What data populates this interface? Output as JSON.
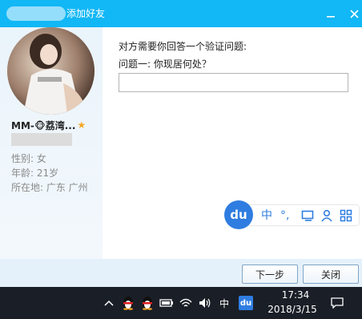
{
  "window": {
    "title": "添加好友",
    "minimize_icon": "minimize-icon",
    "close_icon": "close-icon",
    "title_color": "#12b7f5"
  },
  "profile": {
    "nickname": "MM-🐵荔湾...",
    "star_icon": "star-icon",
    "gender": "性别: 女",
    "age": "年龄: 21岁",
    "location": "所在地: 广东  广州"
  },
  "question": {
    "intro": "对方需要你回答一个验证问题:",
    "q1": "问题一: 你现居何处？",
    "answer_value": ""
  },
  "ime": {
    "logo": "du",
    "lang": "中",
    "punct": "°,",
    "items": [
      "中",
      "°,",
      "keyboard-icon",
      "user-icon",
      "grid-icon"
    ]
  },
  "buttons": {
    "next": "下一步",
    "close": "关闭"
  },
  "taskbar": {
    "ime_lang": "中",
    "baidu_label": "du",
    "time": "17:34",
    "date": "2018/3/15"
  }
}
